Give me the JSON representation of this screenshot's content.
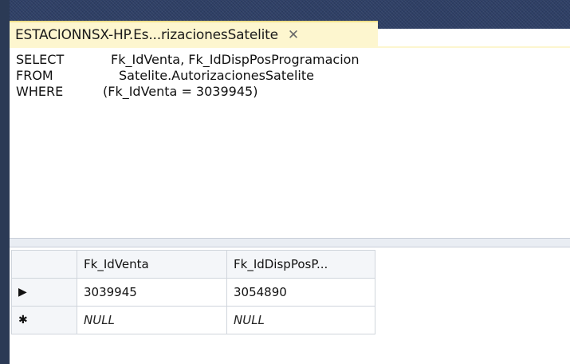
{
  "tab": {
    "title": "ESTACIONNSX-HP.Es...rizacionesSatelite",
    "close_glyph": "✕"
  },
  "sql": {
    "lines": [
      {
        "keyword": "SELECT",
        "text": "Fk_IdVenta, Fk_IdDispPosProgramacion"
      },
      {
        "keyword": "FROM",
        "text": "Satelite.AutorizacionesSatelite"
      },
      {
        "keyword": "WHERE",
        "text": "(Fk_IdVenta = 3039945)"
      }
    ]
  },
  "results": {
    "columns": [
      "Fk_IdVenta",
      "Fk_IdDispPosP..."
    ],
    "rows": [
      {
        "marker": "▶",
        "values": [
          "3039945",
          "3054890"
        ]
      },
      {
        "marker": "✱",
        "values": [
          "NULL",
          "NULL"
        ]
      }
    ]
  },
  "colors": {
    "tab_background": "#fdf6cf",
    "tab_bar": "#2f4066",
    "grid_border": "#d0d5dc"
  },
  "icons": {
    "current_row": "row-pointer-icon",
    "new_row": "asterisk-icon",
    "close": "close-icon"
  }
}
